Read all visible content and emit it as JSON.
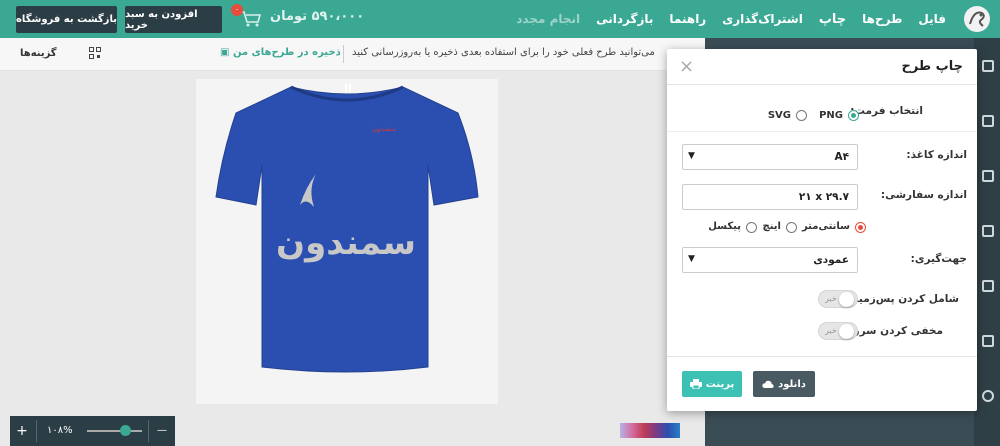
{
  "topbar": {
    "menu": [
      "فایل",
      "طرح‌ها",
      "چاپ",
      "اشتراک‌گذاری",
      "راهنما",
      "بازگردانی",
      "انجام مجدد"
    ],
    "price": "۵۹۰،۰۰۰ تومان",
    "cart_badge": "۰",
    "add_to_cart_label": "افزودن به سبد خرید",
    "back_to_shop_label": "بازگشت به فروشگاه"
  },
  "subbar": {
    "options_label": "گزینه‌ها",
    "save_label": "ذخیره در طرح‌های من",
    "hint": "می‌توانید طرح فعلی خود را برای استفاده بعدی ذخیره یا به‌روزرسانی کنید"
  },
  "canvas": {
    "shirt_text": "سمندون",
    "small_text": "سمندون"
  },
  "zoom": {
    "plus": "+",
    "minus": "—",
    "value": "۱۰۸%"
  },
  "modal": {
    "title": "چاپ طرح",
    "close": "×",
    "format_label": "انتخاب فرمت:",
    "format_png": "PNG",
    "format_svg": "SVG",
    "paper_size_label": "اندازه کاغذ:",
    "paper_size_value": "A۴",
    "custom_size_label": "اندازه سفارشی:",
    "custom_size_value": "۲۱ x ۲۹.۷",
    "unit_cm": "سانتی‌متر",
    "unit_inch": "اینچ",
    "unit_px": "پیکسل",
    "orientation_label": "جهت‌گیری:",
    "orientation_value": "عمودی",
    "include_bg_label": "شامل کردن پس‌زمینه؟",
    "hide_bleed_label": "مخفی کردن سرریز؟",
    "toggle_off": "خیر",
    "download_label": "دانلود",
    "print_label": "پرینت"
  },
  "colors": {
    "accent": "#3ba894",
    "dark": "#2c3e45",
    "shirt": "#2b4fb0",
    "print_button": "#3cc1b4",
    "download_button": "#4a5a62"
  }
}
